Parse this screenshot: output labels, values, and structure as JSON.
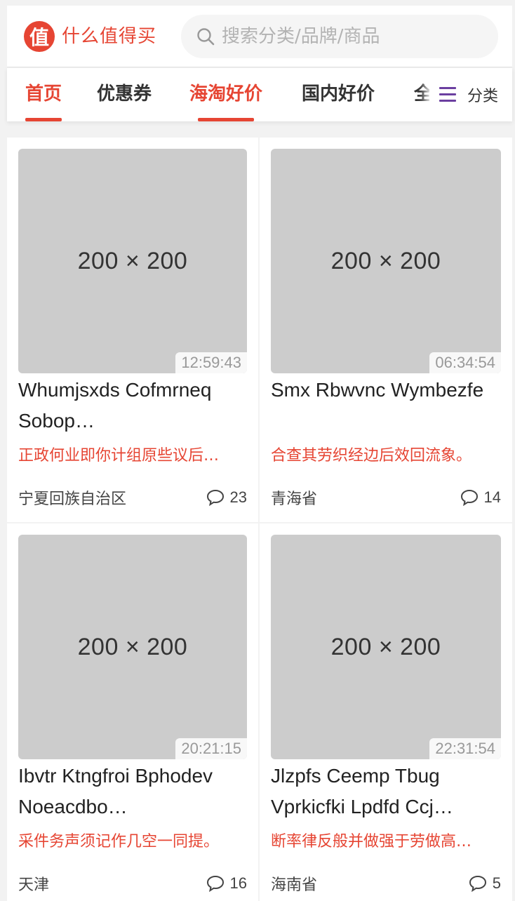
{
  "header": {
    "logo_char": "值",
    "logo_text": "什么值得买",
    "search_placeholder": "搜索分类/品牌/商品"
  },
  "tabs": [
    {
      "label": "首页",
      "active": true
    },
    {
      "label": "优惠券",
      "active": false
    },
    {
      "label": "海淘好价",
      "active": true
    },
    {
      "label": "国内好价",
      "active": false
    },
    {
      "label": "全",
      "active": false
    }
  ],
  "category_button": {
    "label": "分类",
    "icon": "menu-icon"
  },
  "colors": {
    "accent": "#e64533",
    "menu_icon": "#6b3fa0",
    "thumb_bg": "#cccccc"
  },
  "items": [
    {
      "thumb_label": "200 × 200",
      "time": "12:59:43",
      "title": "Whumjsxds Cofmrneq Sobop…",
      "subtitle": "正政何业即你计组原些议后…",
      "location": "宁夏回族自治区",
      "comments": "23"
    },
    {
      "thumb_label": "200 × 200",
      "time": "06:34:54",
      "title": "Smx Rbwvnc Wymbezfe",
      "subtitle": "合查其劳织经边后效回流象。",
      "location": "青海省",
      "comments": "14"
    },
    {
      "thumb_label": "200 × 200",
      "time": "20:21:15",
      "title": "Ibvtr Ktngfroi Bphodev Noeacdbo…",
      "subtitle": "采件务声须记作几空一同提。",
      "location": "天津",
      "comments": "16"
    },
    {
      "thumb_label": "200 × 200",
      "time": "22:31:54",
      "title": "Jlzpfs Ceemp Tbug Vprkicfki Lpdfd Ccj…",
      "subtitle": "断率律反般并做强于劳做高…",
      "location": "海南省",
      "comments": "5"
    }
  ]
}
